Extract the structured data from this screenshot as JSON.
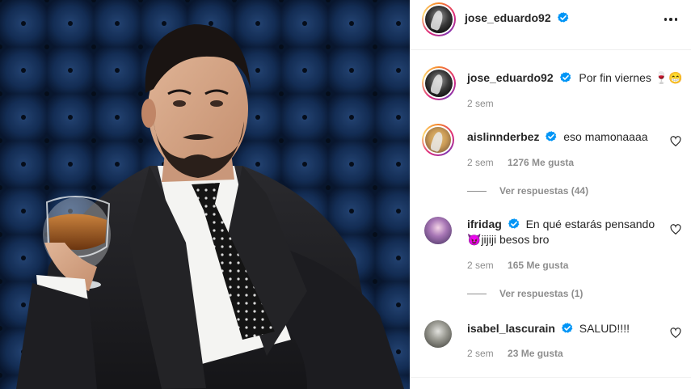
{
  "post": {
    "author": "jose_eduardo92",
    "caption": "Por fin viernes",
    "caption_emoji": "🍷😁",
    "time": "2 sem"
  },
  "comments": [
    {
      "user": "aislinnderbez",
      "verified": true,
      "text": "eso mamonaaaa",
      "time": "2 sem",
      "likes": "1276 Me gusta",
      "replies": "Ver respuestas (44)"
    },
    {
      "user": "ifridag",
      "verified": true,
      "text_line1": "En qué estarás pensando",
      "text_line2_emoji": "😈",
      "text_line2": "jijiji besos bro",
      "time": "2 sem",
      "likes": "165 Me gusta",
      "replies": "Ver respuestas (1)"
    },
    {
      "user": "isabel_lascurain",
      "verified": true,
      "text": "SALUD!!!!",
      "time": "2 sem",
      "likes": "23 Me gusta"
    }
  ],
  "icons": {
    "verified": "verified-badge-icon",
    "more": "more-options-icon",
    "like": "heart-icon"
  },
  "colors": {
    "verified_blue": "#0095f6",
    "meta_gray": "#8e8e8e",
    "text": "#262626",
    "photo_background": "#0e2345"
  }
}
